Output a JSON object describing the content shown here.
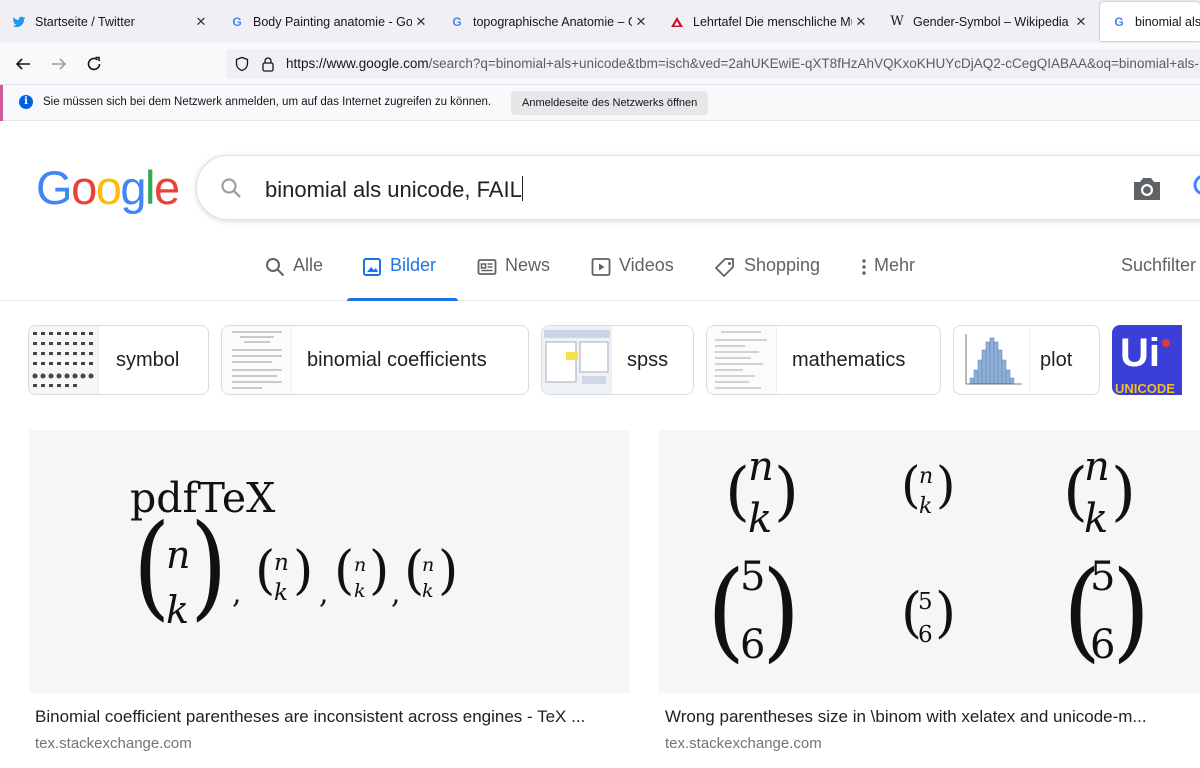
{
  "browser": {
    "tabs": [
      {
        "title": "Startseite / Twitter",
        "icon": "twitter-icon"
      },
      {
        "title": "Body Painting anatomie - Goog",
        "icon": "google-icon"
      },
      {
        "title": "topographische Anatomie – Go",
        "icon": "google-icon"
      },
      {
        "title": "Lehrtafel Die menschliche Musk",
        "icon": "triangle-logo-icon"
      },
      {
        "title": "Gender-Symbol – Wikipedia",
        "icon": "wikipedia-icon"
      },
      {
        "title": "binomial als u",
        "icon": "google-icon"
      }
    ],
    "url_domain": "https://www.google.com",
    "url_rest": "/search?q=binomial+als+unicode&tbm=isch&ved=2ahUKEwiE-qXT8fHzAhVQKxoKHUYcDjAQ2-cCegQIABAA&oq=binomial+als-"
  },
  "notification": {
    "message": "Sie müssen sich bei dem Netzwerk anmelden, um auf das Internet zugreifen zu können.",
    "button_label": "Anmeldeseite des Netzwerks öffnen"
  },
  "search": {
    "query": "binomial als unicode, FAIL"
  },
  "logo": {
    "letters": [
      "G",
      "o",
      "o",
      "g",
      "l",
      "e"
    ],
    "colors": [
      "#4285f4",
      "#ea4335",
      "#fbbc05",
      "#4285f4",
      "#34a853",
      "#ea4335"
    ]
  },
  "tabs": {
    "all": "Alle",
    "images": "Bilder",
    "news": "News",
    "videos": "Videos",
    "shopping": "Shopping",
    "more": "Mehr",
    "filter": "Suchfilter"
  },
  "chips": [
    {
      "label": "symbol"
    },
    {
      "label": "binomial coefficients"
    },
    {
      "label": "spss"
    },
    {
      "label": "mathematics"
    },
    {
      "label": "plot"
    },
    {
      "label": "UNICODE",
      "logo_text": "Ui"
    }
  ],
  "results": [
    {
      "title": "Binomial coefficient parentheses are inconsistent across engines - TeX ...",
      "source": "tex.stackexchange.com",
      "image_heading": "pdfTeX",
      "sep": ","
    },
    {
      "title": "Wrong parentheses size in \\binom with xelatex and unicode-m...",
      "source": "tex.stackexchange.com"
    }
  ],
  "math": {
    "n": "n",
    "k": "k",
    "five": "5",
    "six": "6"
  },
  "accent": "#1a73e8"
}
